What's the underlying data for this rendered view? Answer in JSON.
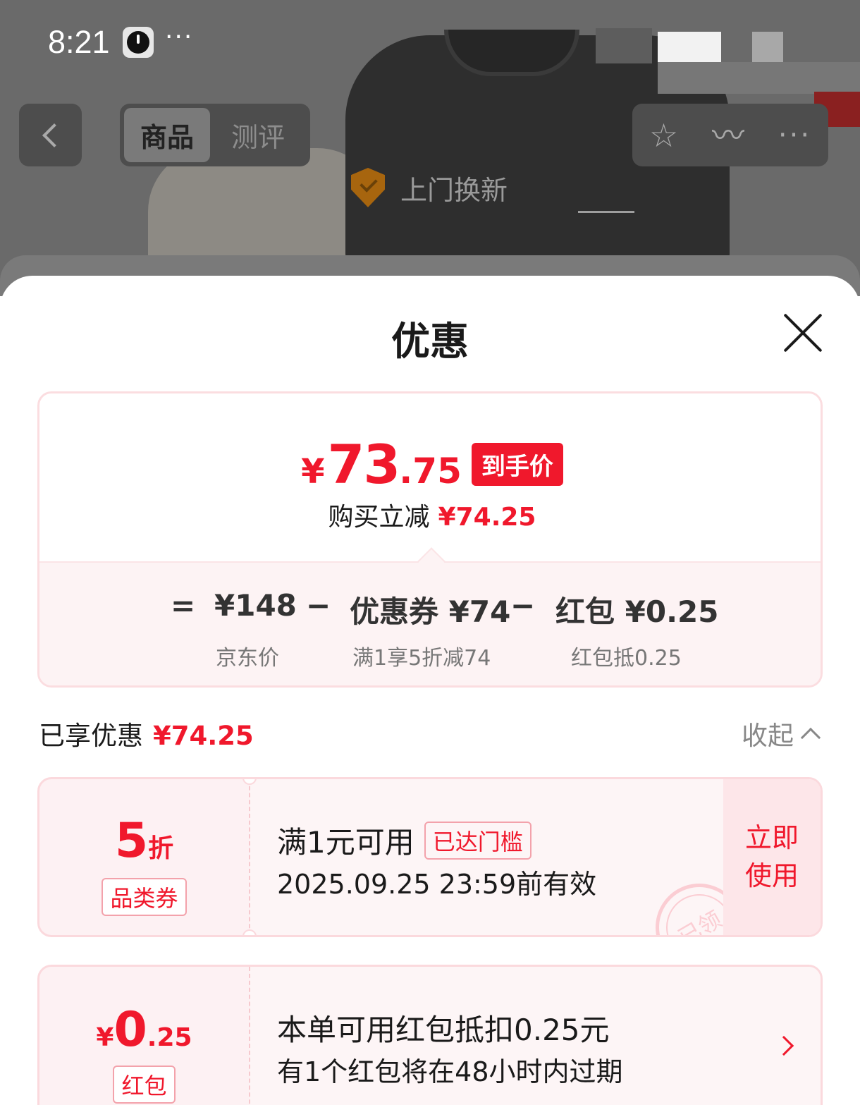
{
  "status_bar": {
    "time": "8:21",
    "more": "···"
  },
  "header": {
    "tabs": [
      {
        "label": "商品"
      },
      {
        "label": "测评"
      }
    ],
    "service_label": "上门换新"
  },
  "sheet": {
    "title": "优惠",
    "final_price": {
      "currency": "¥",
      "integer": "73",
      "decimal": ".75",
      "tag": "到手价"
    },
    "instant_discount": {
      "label": "购买立减",
      "value": "¥74.25"
    },
    "formula": {
      "equals": "=",
      "jd_price": {
        "value": "¥148",
        "caption": "京东价"
      },
      "minus1": "−",
      "coupon": {
        "value": "优惠券 ¥74",
        "caption": "满1享5折减74"
      },
      "minus2": "−",
      "redpacket": {
        "value": "红包 ¥0.25",
        "caption": "红包抵0.25"
      }
    },
    "enjoyed": {
      "label": "已享优惠",
      "value": "¥74.25"
    },
    "collapse_label": "收起",
    "coupons": [
      {
        "value_main": "5",
        "value_unit": "折",
        "badge": "品类券",
        "title": "满1元可用",
        "threshold_tag": "已达门槛",
        "subtitle": "2025.09.25 23:59前有效",
        "action_line1": "立即",
        "action_line2": "使用",
        "stamp": "已领"
      },
      {
        "currency": "¥",
        "value_main": "0",
        "value_decimal": ".25",
        "badge": "红包",
        "title": "本单可用红包抵扣0.25元",
        "subtitle": "有1个红包将在48小时内过期"
      }
    ]
  },
  "colors": {
    "accent_red": "#f0182c",
    "soft_pink": "#fdf1f3"
  }
}
